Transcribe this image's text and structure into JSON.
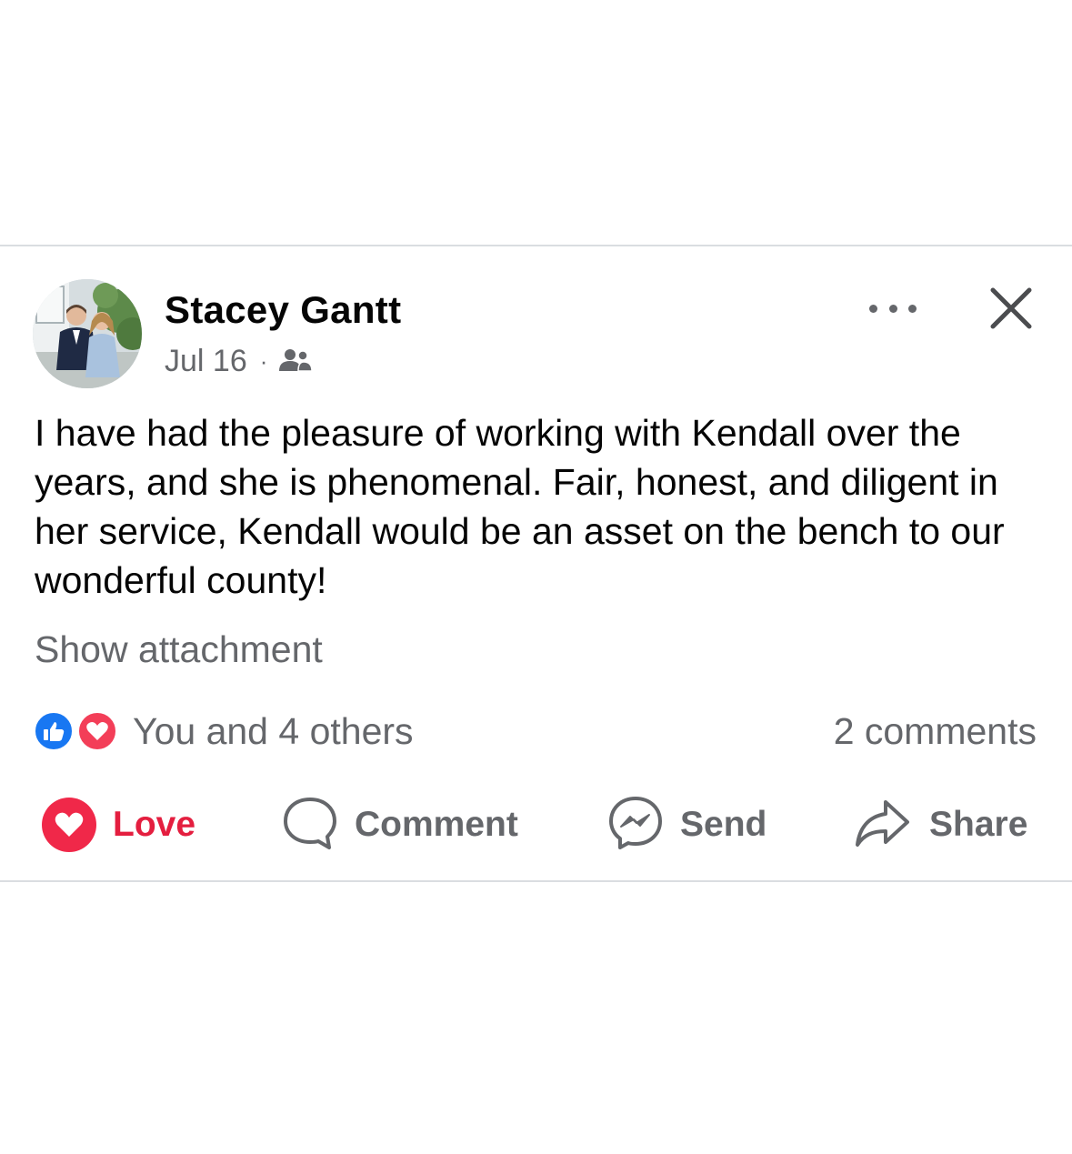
{
  "post": {
    "author": "Stacey Gantt",
    "date": "Jul 16",
    "separator": "·",
    "audience_icon": "friends-icon",
    "text": "I have had the pleasure of working with Kendall over the years, and she is phenomenal. Fair, honest, and diligent in her service, Kendall would be an asset on the bench to our wonderful county!",
    "show_attachment": "Show attachment"
  },
  "reactions": {
    "icons": [
      "like-reaction-icon",
      "love-reaction-icon"
    ],
    "summary": "You and 4 others",
    "comments": "2 comments"
  },
  "actions": {
    "love": "Love",
    "comment": "Comment",
    "send": "Send",
    "share": "Share"
  },
  "colors": {
    "love_red": "#e41e3f",
    "like_blue": "#1877f2",
    "secondary_text": "#65676b",
    "divider": "#dadde1"
  }
}
